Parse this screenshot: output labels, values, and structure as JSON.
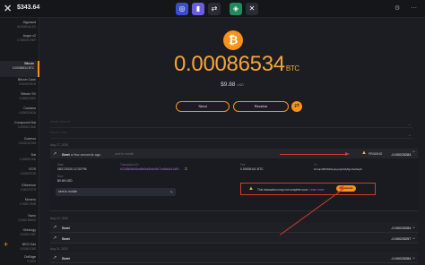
{
  "topbar": {
    "logo_glyph": "✕",
    "balance": "$343.64",
    "apps": [
      {
        "icon": "exodus-ring-icon",
        "glyph": "◎",
        "color": "#3a4ec8"
      },
      {
        "icon": "wallet-icon",
        "glyph": "▮",
        "color": "#6a5de0"
      },
      {
        "icon": "exchange-icon",
        "glyph": "⇄",
        "color": "#2a2c33"
      },
      {
        "icon": "backup-icon",
        "glyph": "◈",
        "color": "#1f8a5e"
      },
      {
        "icon": "x-app-icon",
        "glyph": "✕",
        "color": "#2a2c33"
      }
    ],
    "right_icons": [
      "⚙",
      "⋯"
    ]
  },
  "sidebar": {
    "assets": [
      {
        "name": "Algorand",
        "amount": "46.0000 ALGO"
      },
      {
        "name": "Augur v2",
        "amount": "0.000000 REP"
      },
      {
        "name": "Bitcoin",
        "amount": "0.00086534 BTC",
        "active": true
      },
      {
        "name": "Bitcoin Cash",
        "amount": "0.00000 BCH"
      },
      {
        "name": "Bitcoin SV",
        "amount": "0.00000 BSV"
      },
      {
        "name": "Cardano",
        "amount": "0.00000 ADA"
      },
      {
        "name": "Compound Dai",
        "amount": "0.00000 CDAI"
      },
      {
        "name": "Cosmos",
        "amount": "0.0000 ATOM"
      },
      {
        "name": "Dai",
        "amount": "0.00000 DAI"
      },
      {
        "name": "EOS",
        "amount": "0.0000 EOS"
      },
      {
        "name": "Ethereum",
        "amount": "0.0022 ETH"
      },
      {
        "name": "Monero",
        "amount": "0.0000 XMR"
      },
      {
        "name": "Nano",
        "amount": "0.0000 NANO"
      },
      {
        "name": "Ontology",
        "amount": "0.0000 ONT"
      },
      {
        "name": "NEO Gas",
        "amount": "0.0000 GAS"
      },
      {
        "name": "OnEdge",
        "amount": "0.0000"
      }
    ],
    "add_glyph": "+"
  },
  "wallet": {
    "coin_glyph": "₿",
    "balance": "0.00086534",
    "unit": "BTC",
    "fiat_value": "$9.88",
    "fiat_code": "USD",
    "send_label": "Send",
    "receive_label": "Receive",
    "exchange_glyph": "⇄"
  },
  "faint_rows": [
    "Wallet Balance",
    "Bitcoin Fees"
  ],
  "date_groups": [
    "Aug 17, 2020",
    "Aug 12, 2020",
    "Aug 11, 2020"
  ],
  "pending_tx": {
    "arrow": "↗",
    "type": "Sent",
    "when": "a few seconds ago",
    "to": "sent to mobile",
    "status": "PENDING",
    "amount": "-0.00025284",
    "details": {
      "date_label": "Date",
      "date_value": "08/17/2020 12:33 PM",
      "txid_label": "Transaction ID",
      "txid_value": "b2168b8a06bd6fe6a5bdcf4b7ce8a6dd1a9f...",
      "fee_label": "Fee",
      "fee_value": "0.00006141 BTC",
      "to_label": "To",
      "to_value": "bc1qm0l8tr64ltcyauycgtvfdy5gmhet9ep9",
      "now_label": "Now",
      "now_value": "$0.65 USD",
      "note_value": "sent to mobile",
      "note_edit": "✎",
      "warning_text": "This transaction may not complete soon.",
      "warning_link": "Learn more.",
      "accelerate_label": "Accelerate"
    }
  },
  "history": [
    {
      "arrow": "↗",
      "type": "Sent",
      "amount": "-0.00025284"
    },
    {
      "arrow": "↗",
      "type": "Sent",
      "amount": "-0.00025257"
    },
    {
      "arrow": "↗",
      "type": "Sent",
      "amount": "-0.00025284"
    }
  ],
  "colors": {
    "accent": "#f7931a",
    "annotation": "#d23a2a",
    "warning": "#f7b531",
    "link": "#a56fd8"
  }
}
